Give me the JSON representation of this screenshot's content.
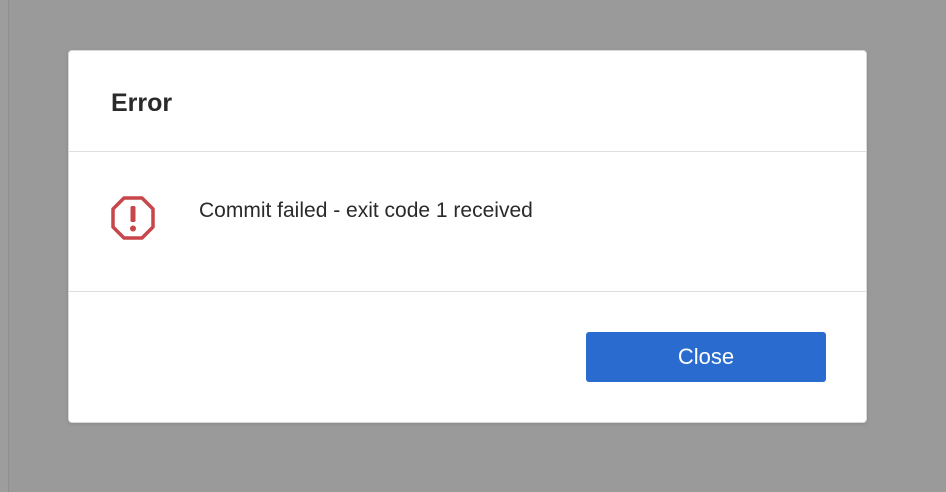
{
  "dialog": {
    "title": "Error",
    "message": "Commit failed - exit code 1 received",
    "icon": "error-octagon-icon",
    "icon_color": "#c8454a",
    "close_label": "Close",
    "button_color": "#2a6bd0"
  }
}
